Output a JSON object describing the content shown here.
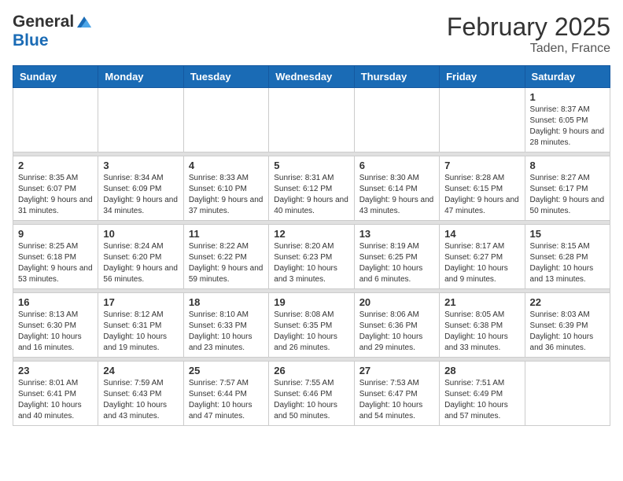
{
  "logo": {
    "line1": "General",
    "line2": "Blue"
  },
  "title": "February 2025",
  "location": "Taden, France",
  "weekdays": [
    "Sunday",
    "Monday",
    "Tuesday",
    "Wednesday",
    "Thursday",
    "Friday",
    "Saturday"
  ],
  "weeks": [
    [
      {
        "day": "",
        "info": ""
      },
      {
        "day": "",
        "info": ""
      },
      {
        "day": "",
        "info": ""
      },
      {
        "day": "",
        "info": ""
      },
      {
        "day": "",
        "info": ""
      },
      {
        "day": "",
        "info": ""
      },
      {
        "day": "1",
        "info": "Sunrise: 8:37 AM\nSunset: 6:05 PM\nDaylight: 9 hours and 28 minutes."
      }
    ],
    [
      {
        "day": "2",
        "info": "Sunrise: 8:35 AM\nSunset: 6:07 PM\nDaylight: 9 hours and 31 minutes."
      },
      {
        "day": "3",
        "info": "Sunrise: 8:34 AM\nSunset: 6:09 PM\nDaylight: 9 hours and 34 minutes."
      },
      {
        "day": "4",
        "info": "Sunrise: 8:33 AM\nSunset: 6:10 PM\nDaylight: 9 hours and 37 minutes."
      },
      {
        "day": "5",
        "info": "Sunrise: 8:31 AM\nSunset: 6:12 PM\nDaylight: 9 hours and 40 minutes."
      },
      {
        "day": "6",
        "info": "Sunrise: 8:30 AM\nSunset: 6:14 PM\nDaylight: 9 hours and 43 minutes."
      },
      {
        "day": "7",
        "info": "Sunrise: 8:28 AM\nSunset: 6:15 PM\nDaylight: 9 hours and 47 minutes."
      },
      {
        "day": "8",
        "info": "Sunrise: 8:27 AM\nSunset: 6:17 PM\nDaylight: 9 hours and 50 minutes."
      }
    ],
    [
      {
        "day": "9",
        "info": "Sunrise: 8:25 AM\nSunset: 6:18 PM\nDaylight: 9 hours and 53 minutes."
      },
      {
        "day": "10",
        "info": "Sunrise: 8:24 AM\nSunset: 6:20 PM\nDaylight: 9 hours and 56 minutes."
      },
      {
        "day": "11",
        "info": "Sunrise: 8:22 AM\nSunset: 6:22 PM\nDaylight: 9 hours and 59 minutes."
      },
      {
        "day": "12",
        "info": "Sunrise: 8:20 AM\nSunset: 6:23 PM\nDaylight: 10 hours and 3 minutes."
      },
      {
        "day": "13",
        "info": "Sunrise: 8:19 AM\nSunset: 6:25 PM\nDaylight: 10 hours and 6 minutes."
      },
      {
        "day": "14",
        "info": "Sunrise: 8:17 AM\nSunset: 6:27 PM\nDaylight: 10 hours and 9 minutes."
      },
      {
        "day": "15",
        "info": "Sunrise: 8:15 AM\nSunset: 6:28 PM\nDaylight: 10 hours and 13 minutes."
      }
    ],
    [
      {
        "day": "16",
        "info": "Sunrise: 8:13 AM\nSunset: 6:30 PM\nDaylight: 10 hours and 16 minutes."
      },
      {
        "day": "17",
        "info": "Sunrise: 8:12 AM\nSunset: 6:31 PM\nDaylight: 10 hours and 19 minutes."
      },
      {
        "day": "18",
        "info": "Sunrise: 8:10 AM\nSunset: 6:33 PM\nDaylight: 10 hours and 23 minutes."
      },
      {
        "day": "19",
        "info": "Sunrise: 8:08 AM\nSunset: 6:35 PM\nDaylight: 10 hours and 26 minutes."
      },
      {
        "day": "20",
        "info": "Sunrise: 8:06 AM\nSunset: 6:36 PM\nDaylight: 10 hours and 29 minutes."
      },
      {
        "day": "21",
        "info": "Sunrise: 8:05 AM\nSunset: 6:38 PM\nDaylight: 10 hours and 33 minutes."
      },
      {
        "day": "22",
        "info": "Sunrise: 8:03 AM\nSunset: 6:39 PM\nDaylight: 10 hours and 36 minutes."
      }
    ],
    [
      {
        "day": "23",
        "info": "Sunrise: 8:01 AM\nSunset: 6:41 PM\nDaylight: 10 hours and 40 minutes."
      },
      {
        "day": "24",
        "info": "Sunrise: 7:59 AM\nSunset: 6:43 PM\nDaylight: 10 hours and 43 minutes."
      },
      {
        "day": "25",
        "info": "Sunrise: 7:57 AM\nSunset: 6:44 PM\nDaylight: 10 hours and 47 minutes."
      },
      {
        "day": "26",
        "info": "Sunrise: 7:55 AM\nSunset: 6:46 PM\nDaylight: 10 hours and 50 minutes."
      },
      {
        "day": "27",
        "info": "Sunrise: 7:53 AM\nSunset: 6:47 PM\nDaylight: 10 hours and 54 minutes."
      },
      {
        "day": "28",
        "info": "Sunrise: 7:51 AM\nSunset: 6:49 PM\nDaylight: 10 hours and 57 minutes."
      },
      {
        "day": "",
        "info": ""
      }
    ]
  ]
}
